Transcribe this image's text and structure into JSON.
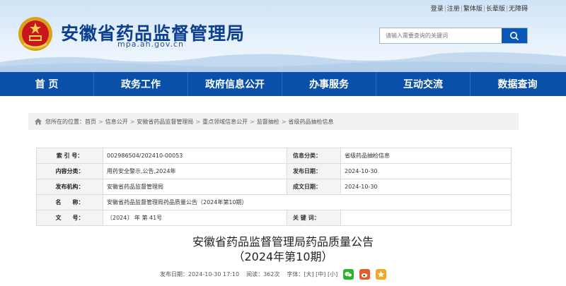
{
  "header": {
    "site_title": "安徽省药品监督管理局",
    "site_url": "mpa.ah.gov.cn",
    "top_links": [
      "登录",
      "注册",
      "繁体版",
      "长辈版",
      "无障碍"
    ],
    "search_placeholder": "请输入需要查询的关键词",
    "search_icon": "magnifier-icon",
    "emblem_icon": "national-emblem-icon"
  },
  "nav": {
    "items": [
      "首 页",
      "政务工作",
      "政府信息公开",
      "办事服务",
      "互动交流",
      "数据查询"
    ]
  },
  "breadcrumb": {
    "prefix": "您所在的位置：",
    "items": [
      "首页",
      "信息公开",
      "安徽省药品监督管理局",
      "重点领域信息公开",
      "监督抽检",
      "省级药品抽检信息"
    ],
    "separator": ">"
  },
  "meta": {
    "index_label": "索 引 号：",
    "index_value": "002986504/202410-00053",
    "category_label": "信息分类：",
    "category_value": "省级药品抽检信息",
    "overview_label": "内容分类：",
    "overview_value": "用药安全警示,公告,2024年",
    "pubdate_label": "发布日期：",
    "pubdate_value": "2024-10-30",
    "publisher_label": "发布机构：",
    "publisher_value": "安徽省药品监督管理局",
    "created_label": "成文日期：",
    "created_value": "2024-10-30",
    "name_label": "名　　称：",
    "name_value": "安徽省药品监督管理局药品质量公告（2024年第10期）",
    "docno_label": "文　　号：",
    "docno_value": "〔2024〕 年 第 41号",
    "keywords_label": "关 键 词：",
    "keywords_value": ""
  },
  "article": {
    "title_line1": "安徽省药品监督管理局药品质量公告",
    "title_line2": "（2024年第10期）",
    "pub_label": "发布日期：2024-10-30 17:10",
    "views_label": "阅读：362次",
    "font_label": "字体：[大] [中] [小]",
    "share_icons": [
      "wechat-icon",
      "weibo-icon",
      "favorite-star-icon"
    ]
  },
  "colors": {
    "nav_bg": "#0a4fa8",
    "title_blue": "#0c3f8f",
    "search_btn": "#0b57b5",
    "wechat": "#2db32d",
    "weibo": "#e85a2a",
    "star": "#f5a623"
  }
}
